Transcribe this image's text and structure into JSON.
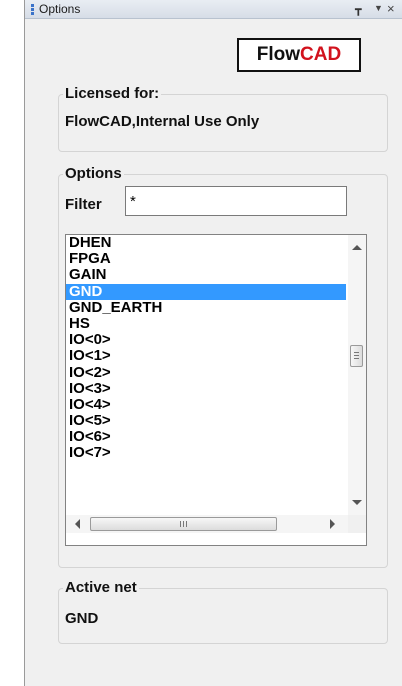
{
  "window": {
    "title": "Options"
  },
  "logo": {
    "part1": "Flow",
    "part2": "CAD"
  },
  "licensed": {
    "label": "Licensed for:",
    "value": "FlowCAD,Internal Use Only"
  },
  "options": {
    "label": "Options",
    "filter_label": "Filter",
    "filter_value": "*",
    "items": [
      "DHEN",
      "FPGA",
      "GAIN",
      "GND",
      "GND_EARTH",
      "HS",
      "IO<0>",
      "IO<1>",
      "IO<2>",
      "IO<3>",
      "IO<4>",
      "IO<5>",
      "IO<6>",
      "IO<7>"
    ],
    "selected": "GND"
  },
  "active_net": {
    "label": "Active net",
    "value": "GND"
  },
  "colors": {
    "selection": "#3399ff",
    "logo_red": "#d2121d"
  },
  "icons": {
    "pin": "pin-icon",
    "menu": "dropdown-icon",
    "close": "close-icon"
  }
}
